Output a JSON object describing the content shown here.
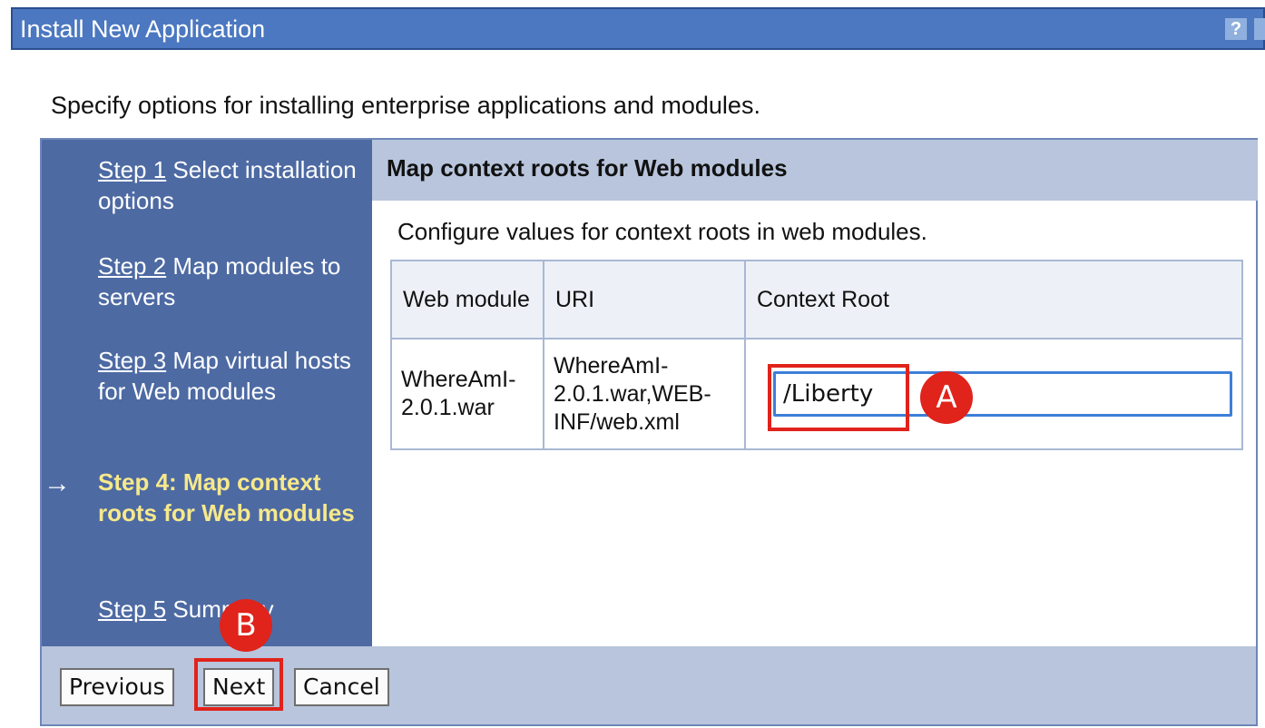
{
  "window": {
    "title": "Install New Application",
    "help_label": "?"
  },
  "intro_text": "Specify options for installing enterprise applications and modules.",
  "steps": [
    {
      "link": "Step 1",
      "text": "Select installation options"
    },
    {
      "link": "Step 2",
      "text": "Map modules to servers"
    },
    {
      "link": "Step 3",
      "text": "Map virtual hosts for Web modules"
    },
    {
      "current": "Step 4: Map context roots for Web modules"
    },
    {
      "link": "Step 5",
      "text": "Summary"
    }
  ],
  "current_marker": "→",
  "content": {
    "heading": "Map context roots for Web modules",
    "description": "Configure values for context roots in web modules.",
    "table": {
      "headers": [
        "Web module",
        "URI",
        "Context Root"
      ],
      "rows": [
        {
          "web_module": "WhereAmI-2.0.1.war",
          "uri": "WhereAmI-2.0.1.war,WEB-INF/web.xml",
          "context_root": "/Liberty"
        }
      ]
    }
  },
  "buttons": {
    "previous": "Previous",
    "next": "Next",
    "cancel": "Cancel"
  },
  "annotations": {
    "a": "A",
    "b": "B",
    "color": "#e0231b"
  }
}
